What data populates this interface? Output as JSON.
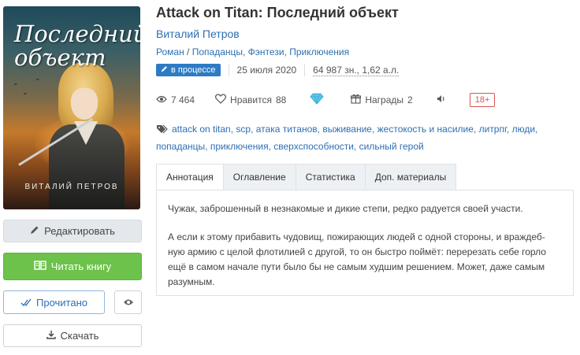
{
  "book": {
    "title": "Attack on Titan: Последний объект",
    "author": "Виталий Петров",
    "genres": [
      "Роман",
      "Попаданцы",
      "Фэнтези",
      "Приключения"
    ],
    "status": "в процессе",
    "date": "25 июля 2020",
    "size": "64 987 зн., 1,62 а.л."
  },
  "cover": {
    "title": "Последний объект",
    "author": "ВИТАЛИЙ ПЕТРОВ"
  },
  "stats": {
    "views": "7 464",
    "likes_label": "Нравится",
    "likes": "88",
    "awards_label": "Награды",
    "awards": "2",
    "age_rating": "18+"
  },
  "tags": [
    "attack on titan",
    "scp",
    "атака титанов",
    "выживание",
    "жестокость и насилие",
    "литрпг",
    "люди",
    "попаданцы",
    "приключения",
    "сверхспособности",
    "сильный герой"
  ],
  "tabs": [
    "Аннотация",
    "Оглавление",
    "Статистика",
    "Доп. материалы"
  ],
  "annotation": {
    "p1": "Чужак, заброшенный в незнакомые и дикие степи, редко радуется своей участи.",
    "p2": "А если к этому прибавить чудовищ, пожирающих людей с одной стороны, и враждеб- ную армию с целой флотилией с другой, то он быстро поймёт: перерезать себе горло ещё в самом начале пути было бы не самым худшим решением. Может, даже самым разумным."
  },
  "buttons": {
    "edit": "Редактировать",
    "read": "Читать книгу",
    "done": "Прочитано",
    "download": "Скачать"
  },
  "colors": {
    "link": "#2d6fb3",
    "read_button": "#6cc24a",
    "status_badge": "#2d7bc4",
    "age_badge": "#d9534f"
  },
  "icons": [
    "pencil-icon",
    "book-icon",
    "check-icon",
    "eye-icon",
    "download-icon",
    "views-eye-icon",
    "heart-icon",
    "diamond-icon",
    "gift-icon",
    "speaker-icon",
    "tag-icon"
  ]
}
